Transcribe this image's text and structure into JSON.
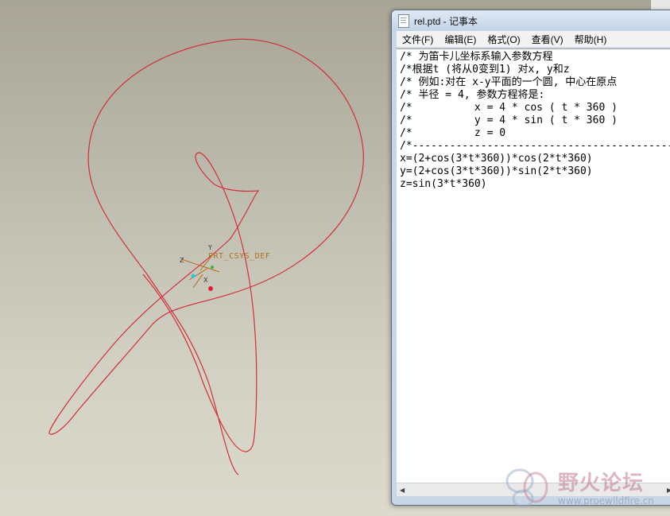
{
  "canvas": {
    "csys_label": "PRT_CSYS_DEF",
    "curve_color": "#d0303a",
    "axis_x_label": "X",
    "axis_y_label": "Y",
    "axis_z_label": "Z"
  },
  "notepad": {
    "title": "rel.ptd - 记事本",
    "menu": [
      "文件(F)",
      "编辑(E)",
      "格式(O)",
      "查看(V)",
      "帮助(H)"
    ],
    "lines": [
      "/* 为笛卡儿坐标系输入参数方程",
      "/*根据t (将从0变到1) 对x, y和z",
      "/* 例如:对在 x-y平面的一个圆, 中心在原点",
      "/* 半径 = 4, 参数方程将是:",
      "/*          x = 4 * cos ( t * 360 )",
      "/*          y = 4 * sin ( t * 360 )",
      "/*          z = 0",
      "/*------------------------------------------",
      "x=(2+cos(3*t*360))*cos(2*t*360)",
      "y=(2+cos(3*t*360))*sin(2*t*360)",
      "z=sin(3*t*360)"
    ]
  },
  "watermark": {
    "title": "野火论坛",
    "url": "www.proewildfire.cn"
  }
}
